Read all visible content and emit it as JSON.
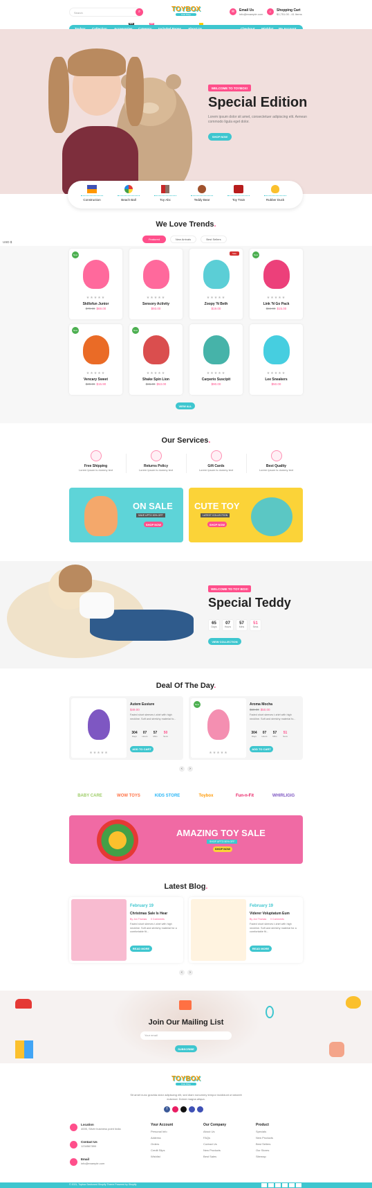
{
  "header": {
    "search_placeholder": "Search",
    "logo_line1": "TOYBOX",
    "logo_line2": "Kids Shop",
    "email_label": "Email Us",
    "email_value": "info@example.com",
    "cart_label": "Shopping Cart",
    "cart_value": "$1,751.00 - 41 Items"
  },
  "nav": {
    "items": [
      "Toybox",
      "Collection",
      "Accessories",
      "Category",
      "Included Pages",
      "About Us"
    ],
    "badges": [
      "NEW",
      "HOT",
      ""
    ],
    "right": [
      "Checkout",
      "Wishlist",
      "My Account"
    ]
  },
  "hero": {
    "tag": "WELCOME TO TOYBOX!",
    "title": "Special Edition",
    "text": "Lorem ipsum dolor sit amet, consectetuer adipiscing elit. Aenean commodo ligula eget dolor.",
    "button": "SHOP NOW"
  },
  "categories": [
    "Construction",
    "Beach Ball",
    "Toy Abc",
    "Teddy Bear",
    "Toy Train",
    "Rubber Duck"
  ],
  "currency": "USD $",
  "trends": {
    "title": "We Love Trends",
    "tabs": [
      "Featured",
      "New Arrivals",
      "Best Sellers"
    ],
    "button": "VIEW ALL"
  },
  "products": [
    {
      "name": "Skillofun Junior",
      "old": "$79.99",
      "price": "$69.00",
      "badge": "New"
    },
    {
      "name": "Sensory Activity",
      "old": "",
      "price": "$93.00",
      "badge": ""
    },
    {
      "name": "Zoopy 'N Beth",
      "old": "",
      "price": "$19.00",
      "badge": "Sale"
    },
    {
      "name": "Link 'N Go Pack",
      "old": "$34.99",
      "price": "$15.00",
      "badge": "New"
    },
    {
      "name": "Vencary Sweet",
      "old": "$39.99",
      "price": "$15.90",
      "badge": "New"
    },
    {
      "name": "Shake Spin Lion",
      "old": "$65.00",
      "price": "$53.00",
      "badge": "New"
    },
    {
      "name": "Carperio Suscipit",
      "old": "",
      "price": "$90.00",
      "badge": ""
    },
    {
      "name": "Lee Sneakers",
      "old": "",
      "price": "$50.00",
      "badge": ""
    }
  ],
  "services": {
    "title": "Our Services",
    "items": [
      {
        "name": "Free Shipping",
        "text": "Lorem Ipsum is dummy text"
      },
      {
        "name": "Returns Policy",
        "text": "Lorem Ipsum is dummy text"
      },
      {
        "name": "Gift Cards",
        "text": "Lorem Ipsum is dummy text"
      },
      {
        "name": "Best Quality",
        "text": "Lorem Ipsum is dummy text"
      }
    ]
  },
  "banners": [
    {
      "title": "ON SALE",
      "sub": "SAVE UPTO 30% OFF",
      "button": "SHOP NOW"
    },
    {
      "title": "CUTE TOY",
      "sub": "LATEST COLLECTION",
      "button": "SHOP NOW"
    }
  ],
  "teddy": {
    "tag": "WELCOME TO TOY BOX!",
    "title": "Special Teddy",
    "counts": [
      "65",
      "07",
      "57",
      "51"
    ],
    "labels": [
      "Days",
      "Hours",
      "Mins",
      "Secs"
    ],
    "button": "VIEW COLLECTION"
  },
  "deal": {
    "title": "Deal Of The Day",
    "items": [
      {
        "name": "Autem Eusiure",
        "old": "$49.00",
        "price": "",
        "text": "Faded short sleeves t-shirt with high neckline. Soft and stretchy material fo...",
        "counts": [
          "304",
          "07",
          "57",
          "50"
        ],
        "button": "ADD TO CART",
        "badge": ""
      },
      {
        "name": "Aroma Mocha",
        "old": "$69.00",
        "price": "$50.00",
        "text": "Faded short sleeves t-shirt with high neckline. Soft and stretchy material fo...",
        "counts": [
          "304",
          "07",
          "57",
          "51"
        ],
        "button": "ADD TO CART",
        "badge": "New"
      }
    ],
    "labels": [
      "Days",
      "Hours",
      "Mins",
      "Secs"
    ]
  },
  "brands": [
    "BABY CARE",
    "WOW TOYS",
    "KIDS STORE",
    "Toybox",
    "Fun-n-Fit",
    "WHIRLIGIG"
  ],
  "big_banner": {
    "title": "AMAZING TOY SALE",
    "sub": "SHOP UPTO 50% OFF",
    "button": "SHOP NOW"
  },
  "blog": {
    "title": "Latest Blog",
    "posts": [
      {
        "date": "February 19",
        "title": "Christmas Sale Is Hear",
        "by": "By Jon Thomas",
        "comments": "0 Comments",
        "text": "Faded short sleeves t-shirt with high neckline. Soft and stretchy material for a comfortable fit...",
        "button": "READ MORE"
      },
      {
        "date": "February 19",
        "title": "Viderer Voluptatum Eum",
        "by": "By Jon Thomas",
        "comments": "0 Comments",
        "text": "Faded short sleeves t-shirt with high neckline. Soft and stretchy material for a comfortable fit...",
        "button": "READ MORE"
      }
    ]
  },
  "newsletter": {
    "title": "Join Our Mailing List",
    "placeholder": "Your email",
    "button": "SUBSCRIBE"
  },
  "footer": {
    "about": "Sit amet nunc gravida dolor adipiscing elit, sed diam nonummy tempor incididunt ut laboreit euismod. Dolore magna aliqua.",
    "contact": [
      {
        "label": "Location",
        "value": "4005, Silver business point India"
      },
      {
        "label": "Contact Us",
        "value": "1234567890"
      },
      {
        "label": "Email",
        "value": "info@example.com"
      }
    ],
    "cols": [
      {
        "title": "Your Account",
        "links": [
          "Personal Info",
          "Address",
          "Orders",
          "Credit Slips",
          "Wishlist"
        ]
      },
      {
        "title": "Our Company",
        "links": [
          "About Us",
          "FAQs",
          "Contact Us",
          "New Products",
          "Best Sales"
        ]
      },
      {
        "title": "Product",
        "links": [
          "Specials",
          "New Products",
          "Best Sellers",
          "Our Stores",
          "Sitemap"
        ]
      }
    ],
    "copyright": "© 2021, Toybox Sectioned Shopify Theme Powered by Shopify"
  }
}
